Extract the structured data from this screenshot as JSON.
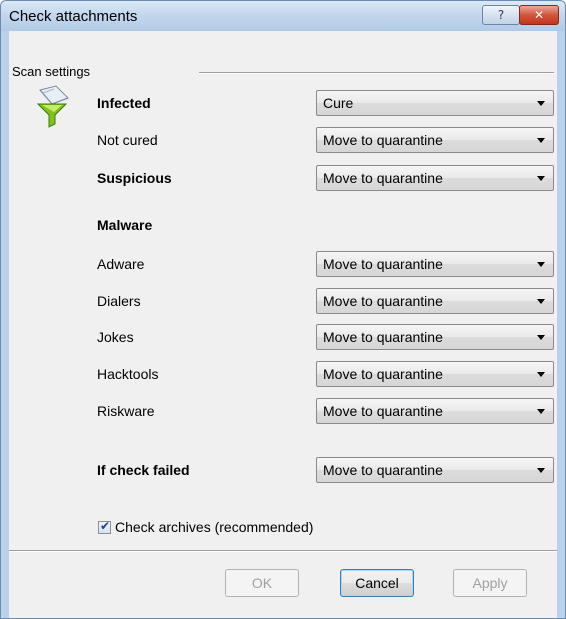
{
  "window": {
    "title": "Check attachments",
    "help_label": "?",
    "close_label": "✕"
  },
  "scan_settings": {
    "header": "Scan settings",
    "icon": "mail-filter-icon",
    "rows": [
      {
        "label": "Infected",
        "value": "Cure"
      },
      {
        "label": "Not cured",
        "value": "Move to quarantine"
      },
      {
        "label": "Suspicious",
        "value": "Move to quarantine"
      },
      {
        "label": "Malware"
      },
      {
        "label": "Adware",
        "value": "Move to quarantine"
      },
      {
        "label": "Dialers",
        "value": "Move to quarantine"
      },
      {
        "label": "Jokes",
        "value": "Move to quarantine"
      },
      {
        "label": "Hacktools",
        "value": "Move to quarantine"
      },
      {
        "label": "Riskware",
        "value": "Move to quarantine"
      },
      {
        "label": "If check failed",
        "value": "Move to quarantine"
      }
    ]
  },
  "check_archives": {
    "label": "Check archives (recommended)",
    "checked": true
  },
  "buttons": {
    "ok": "OK",
    "cancel": "Cancel",
    "apply": "Apply"
  },
  "colors": {
    "frame": "#b9d1ea",
    "client": "#f0f0f0",
    "close_button": "#c9402a"
  }
}
